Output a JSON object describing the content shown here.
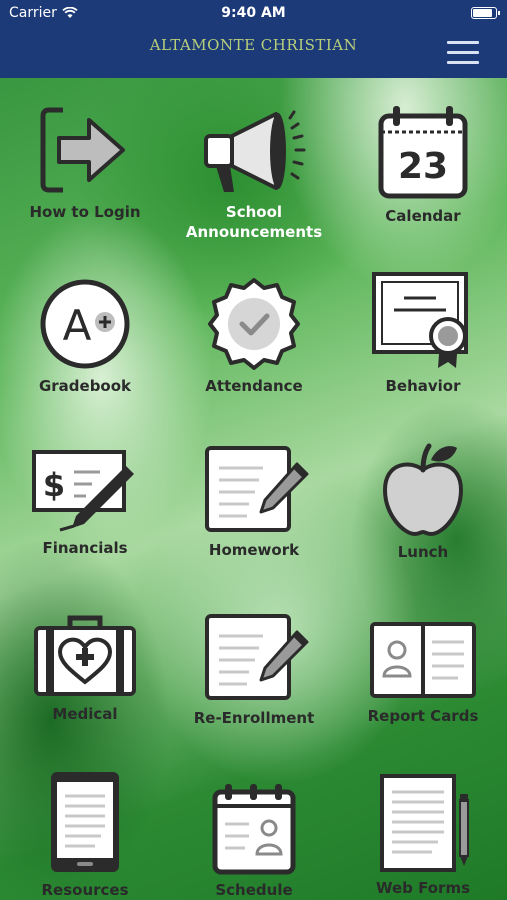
{
  "status_bar": {
    "carrier": "Carrier",
    "time": "9:40 AM",
    "battery_level": 0.95
  },
  "header": {
    "title": "ALTAMONTE CHRISTIAN",
    "title_color": "#b8cf7a",
    "background": "#1c3a78",
    "menu_icon": "hamburger-menu-icon"
  },
  "tiles": [
    {
      "label": "How to Login",
      "icon": "login-arrow-icon"
    },
    {
      "label": "School Announcements",
      "line1": "School",
      "line2": "Announcements",
      "icon": "megaphone-icon"
    },
    {
      "label": "Calendar",
      "icon": "calendar-icon",
      "day": "23"
    },
    {
      "label": "Gradebook",
      "icon": "grade-a-plus-icon"
    },
    {
      "label": "Attendance",
      "icon": "checkmark-badge-icon"
    },
    {
      "label": "Behavior",
      "icon": "certificate-icon"
    },
    {
      "label": "Financials",
      "icon": "check-dollar-icon"
    },
    {
      "label": "Homework",
      "icon": "notepad-pencil-icon"
    },
    {
      "label": "Lunch",
      "icon": "apple-icon"
    },
    {
      "label": "Medical",
      "icon": "medical-kit-icon"
    },
    {
      "label": "Re-Enrollment",
      "icon": "notepad-pencil-icon"
    },
    {
      "label": "Report Cards",
      "icon": "id-card-icon"
    },
    {
      "label": "Resources",
      "icon": "tablet-icon"
    },
    {
      "label": "Schedule",
      "icon": "schedule-calendar-icon"
    },
    {
      "label": "Web Forms",
      "icon": "document-pen-icon"
    }
  ]
}
